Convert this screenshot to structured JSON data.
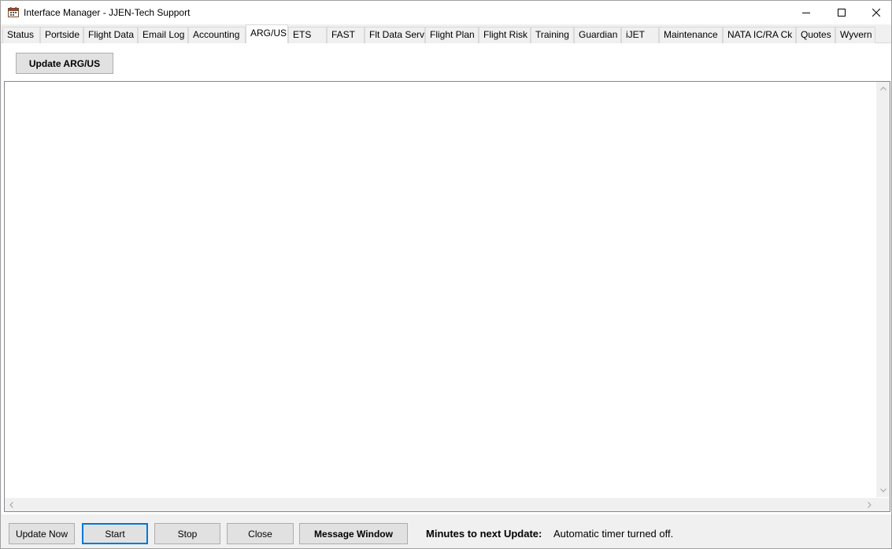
{
  "window": {
    "title": "Interface Manager - JJEN-Tech Support",
    "app_icon": "calendar-app-icon",
    "controls": {
      "minimize_icon": "minimize-icon",
      "maximize_icon": "maximize-icon",
      "close_icon": "close-icon"
    }
  },
  "tabs": [
    {
      "label": "Status"
    },
    {
      "label": "Portside"
    },
    {
      "label": "Flight Data"
    },
    {
      "label": "Email Log"
    },
    {
      "label": "Accounting"
    },
    {
      "label": "ARG/US",
      "active": true
    },
    {
      "label": "ETS"
    },
    {
      "label": "FAST"
    },
    {
      "label": "Flt Data Serv"
    },
    {
      "label": "Flight Plan"
    },
    {
      "label": "Flight Risk"
    },
    {
      "label": "Training"
    },
    {
      "label": "Guardian"
    },
    {
      "label": "iJET"
    },
    {
      "label": "Maintenance"
    },
    {
      "label": "NATA IC/RA Ck"
    },
    {
      "label": "Quotes"
    },
    {
      "label": "Wyvern"
    }
  ],
  "tabpage": {
    "update_button_label": "Update ARG/US",
    "log_text": ""
  },
  "bottom": {
    "update_now_label": "Update Now",
    "start_label": "Start",
    "stop_label": "Stop",
    "close_label": "Close",
    "message_window_label": "Message Window",
    "minutes_label": "Minutes to next Update:",
    "minutes_value": "Automatic timer turned off."
  },
  "colors": {
    "focus_accent": "#0078d7",
    "button_face": "#e1e1e1",
    "window_bg": "#f0f0f0"
  }
}
